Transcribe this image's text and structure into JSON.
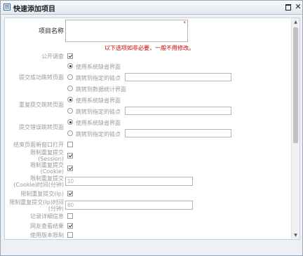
{
  "window": {
    "title": "快速添加项目",
    "maximize_label": "",
    "close_label": "✕"
  },
  "project_name": {
    "label": "项目名称",
    "value": "",
    "required_mark": "*",
    "note": "以下选项如非必要，一般不用修改。"
  },
  "public_survey": {
    "label": "公开调查",
    "checked": true
  },
  "submit_success": {
    "label": "提交成功跳转页面",
    "options": [
      {
        "text": "使用系统缺省界面",
        "checked": true
      },
      {
        "text": "跳转到指定的链点",
        "checked": false
      },
      {
        "text": "跳转到数据统计界面",
        "checked": false
      }
    ],
    "url_value": ""
  },
  "repeat_submit": {
    "label": "重复提交跳转页面",
    "options": [
      {
        "text": "使用系统缺省界面",
        "checked": true
      },
      {
        "text": "跳转到指定的链点",
        "checked": false
      }
    ],
    "url_value": ""
  },
  "submit_error": {
    "label": "提交错误跳转页面",
    "options": [
      {
        "text": "使用系统缺省界面",
        "checked": true
      },
      {
        "text": "跳转到指定的链点",
        "checked": false
      }
    ],
    "url_value": ""
  },
  "end_new_window": {
    "label": "结束页面新窗口打开",
    "checked": false
  },
  "limit_session": {
    "label_line1": "限制重复提交",
    "label_line2": "(Session)",
    "checked": true
  },
  "limit_cookie": {
    "label_line1": "限制重复提交",
    "label_line2": "(Cookie)",
    "checked": true
  },
  "limit_cookie_time": {
    "label_line1": "限制重复提交",
    "label_line2": "(Cookie)时间(分钟)",
    "value": "10"
  },
  "limit_ip": {
    "label": "限制重复提交(Ip)",
    "checked": true
  },
  "limit_ip_time": {
    "label_line1": "限制重复提交(Ip)时间",
    "label_line2": "(分钟)",
    "value": "60"
  },
  "record_details": {
    "label": "记录详细信息",
    "checked": false
  },
  "view_results": {
    "label": "网友查看结果",
    "checked": true
  },
  "version_limit": {
    "label": "使用版本限制",
    "checked": false
  },
  "scrollbar": {
    "up": "▲",
    "down": "▼"
  }
}
